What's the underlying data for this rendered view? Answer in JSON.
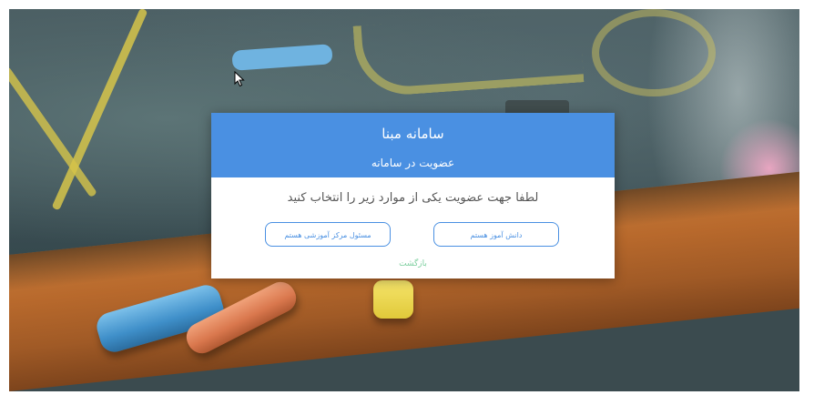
{
  "modal": {
    "title": "سامانه مبنا",
    "subtitle": "عضویت در سامانه",
    "instruction": "لطفا جهت عضویت یکی از موارد زیر را انتخاب کنید",
    "buttons": {
      "student": "دانش آموز هستم",
      "center_manager": "مسئول مرکز آموزشی هستم"
    },
    "back_link": "بازگشت"
  },
  "colors": {
    "accent": "#4a90e2",
    "back_link": "#7fd0a0",
    "header_text": "#ffffff"
  },
  "icons": {
    "cursor": "mouse-pointer-icon"
  }
}
